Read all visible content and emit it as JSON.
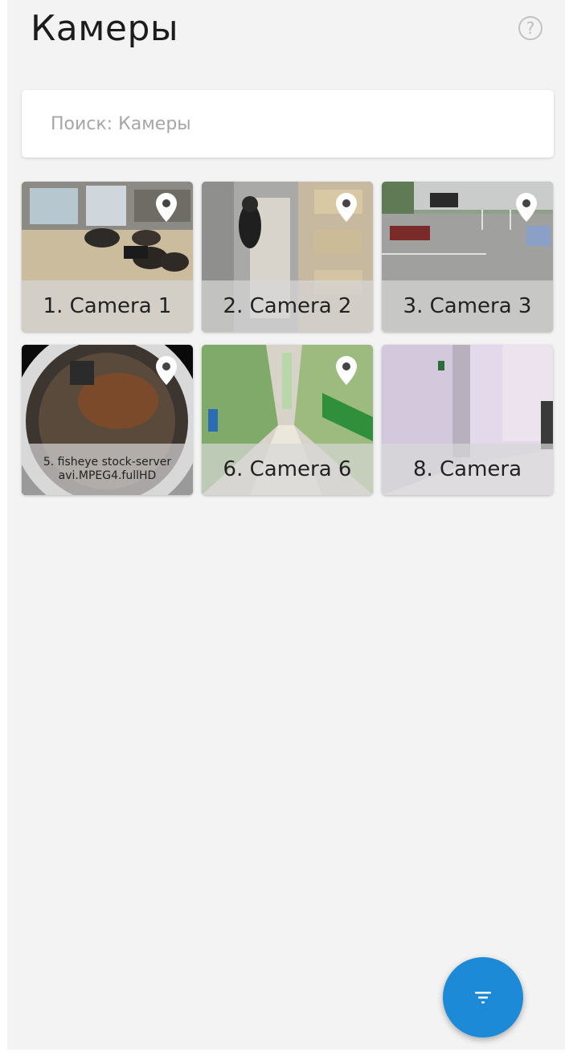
{
  "header": {
    "title": "Камеры",
    "help_icon": "question-circle-icon",
    "help_glyph": "?"
  },
  "search": {
    "placeholder": "Поиск: Камеры",
    "value": ""
  },
  "cameras": [
    {
      "name": "1. Camera 1",
      "has_location": true
    },
    {
      "name": "2. Camera 2",
      "has_location": true
    },
    {
      "name": "3. Camera 3",
      "has_location": true
    },
    {
      "name": "5. fisheye stock-server avi.MPEG4.fullHD",
      "has_location": true
    },
    {
      "name": "6. Camera 6",
      "has_location": true
    },
    {
      "name": "8. Camera",
      "has_location": false
    }
  ],
  "fab": {
    "icon": "filter-icon",
    "color": "#1d8ad8"
  },
  "colors": {
    "background": "#f3f3f3",
    "accent": "#1d8ad8"
  }
}
